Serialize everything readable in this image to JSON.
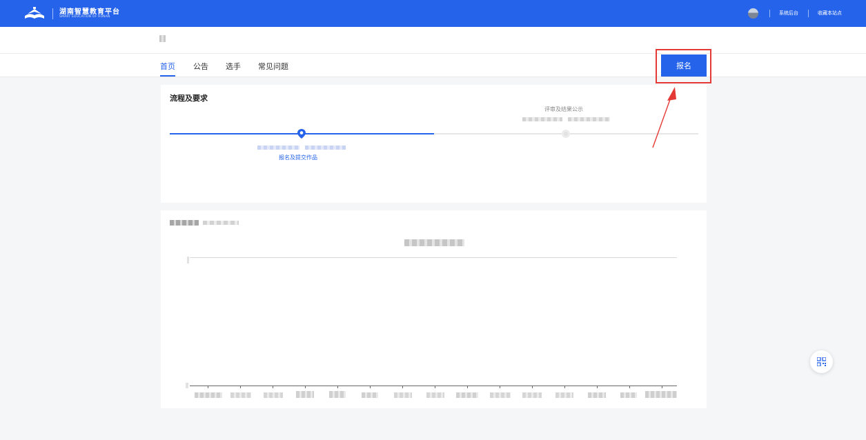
{
  "header": {
    "brand_title": "湖南智慧教育平台",
    "brand_subtitle": "SMART EDUCATION OF HUNAN",
    "links": [
      "系统后台",
      "收藏本站点"
    ]
  },
  "nav": {
    "tabs": [
      "首页",
      "公告",
      "选手",
      "常见问题"
    ],
    "active_tab": "首页",
    "signup_button": "报名"
  },
  "process": {
    "title": "流程及要求",
    "steps": [
      {
        "label": "报名及提交作品",
        "status": "current"
      },
      {
        "label": "评审及结果公示",
        "status": "upcoming"
      }
    ]
  },
  "colors": {
    "primary": "#2563ea",
    "highlight": "#e53935",
    "inactive": "#e6e6e6"
  },
  "icons": {
    "logo": "book-logo-icon",
    "current_step": "location-pin-icon",
    "float": "qr-code-icon"
  }
}
